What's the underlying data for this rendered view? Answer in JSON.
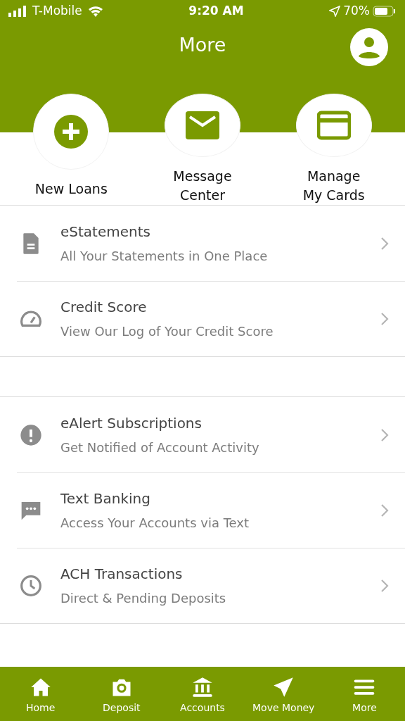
{
  "status_bar": {
    "carrier": "T-Mobile",
    "time": "9:20 AM",
    "battery": "70%"
  },
  "header": {
    "title": "More"
  },
  "shortcuts": [
    {
      "label": "New Loans"
    },
    {
      "label": "Message\nCenter"
    },
    {
      "label": "Manage\nMy Cards"
    }
  ],
  "sections": [
    [
      {
        "title": "eStatements",
        "subtitle": "All Your Statements in One Place"
      },
      {
        "title": "Credit Score",
        "subtitle": "View Our Log of Your Credit Score"
      }
    ],
    [
      {
        "title": "eAlert Subscriptions",
        "subtitle": "Get Notified of Account Activity"
      },
      {
        "title": "Text Banking",
        "subtitle": "Access Your Accounts via Text"
      },
      {
        "title": "ACH Transactions",
        "subtitle": "Direct & Pending Deposits"
      }
    ]
  ],
  "tab_bar": [
    {
      "label": "Home"
    },
    {
      "label": "Deposit"
    },
    {
      "label": "Accounts"
    },
    {
      "label": "Move Money"
    },
    {
      "label": "More"
    }
  ]
}
